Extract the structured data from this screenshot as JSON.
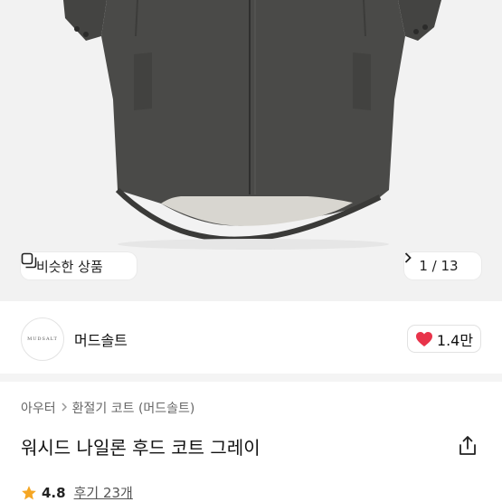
{
  "gallery": {
    "similar_label": "비슷한 상품",
    "counter": "1 / 13"
  },
  "brand": {
    "logo_text": "MUDSALT",
    "name": "머드솔트",
    "likes": "1.4만",
    "heart_color": "#e8334a"
  },
  "product": {
    "breadcrumb": [
      "아우터",
      "환절기 코트 (머드솔트)"
    ],
    "title": "워시드 나일론 후드 코트 그레이",
    "rating": "4.8",
    "reviews": "후기 23개",
    "star_color": "#f5a623"
  },
  "icons": [
    "similar-products-icon",
    "chevron-right-icon",
    "heart-icon",
    "chevron-right-small-icon",
    "share-icon",
    "star-icon"
  ]
}
